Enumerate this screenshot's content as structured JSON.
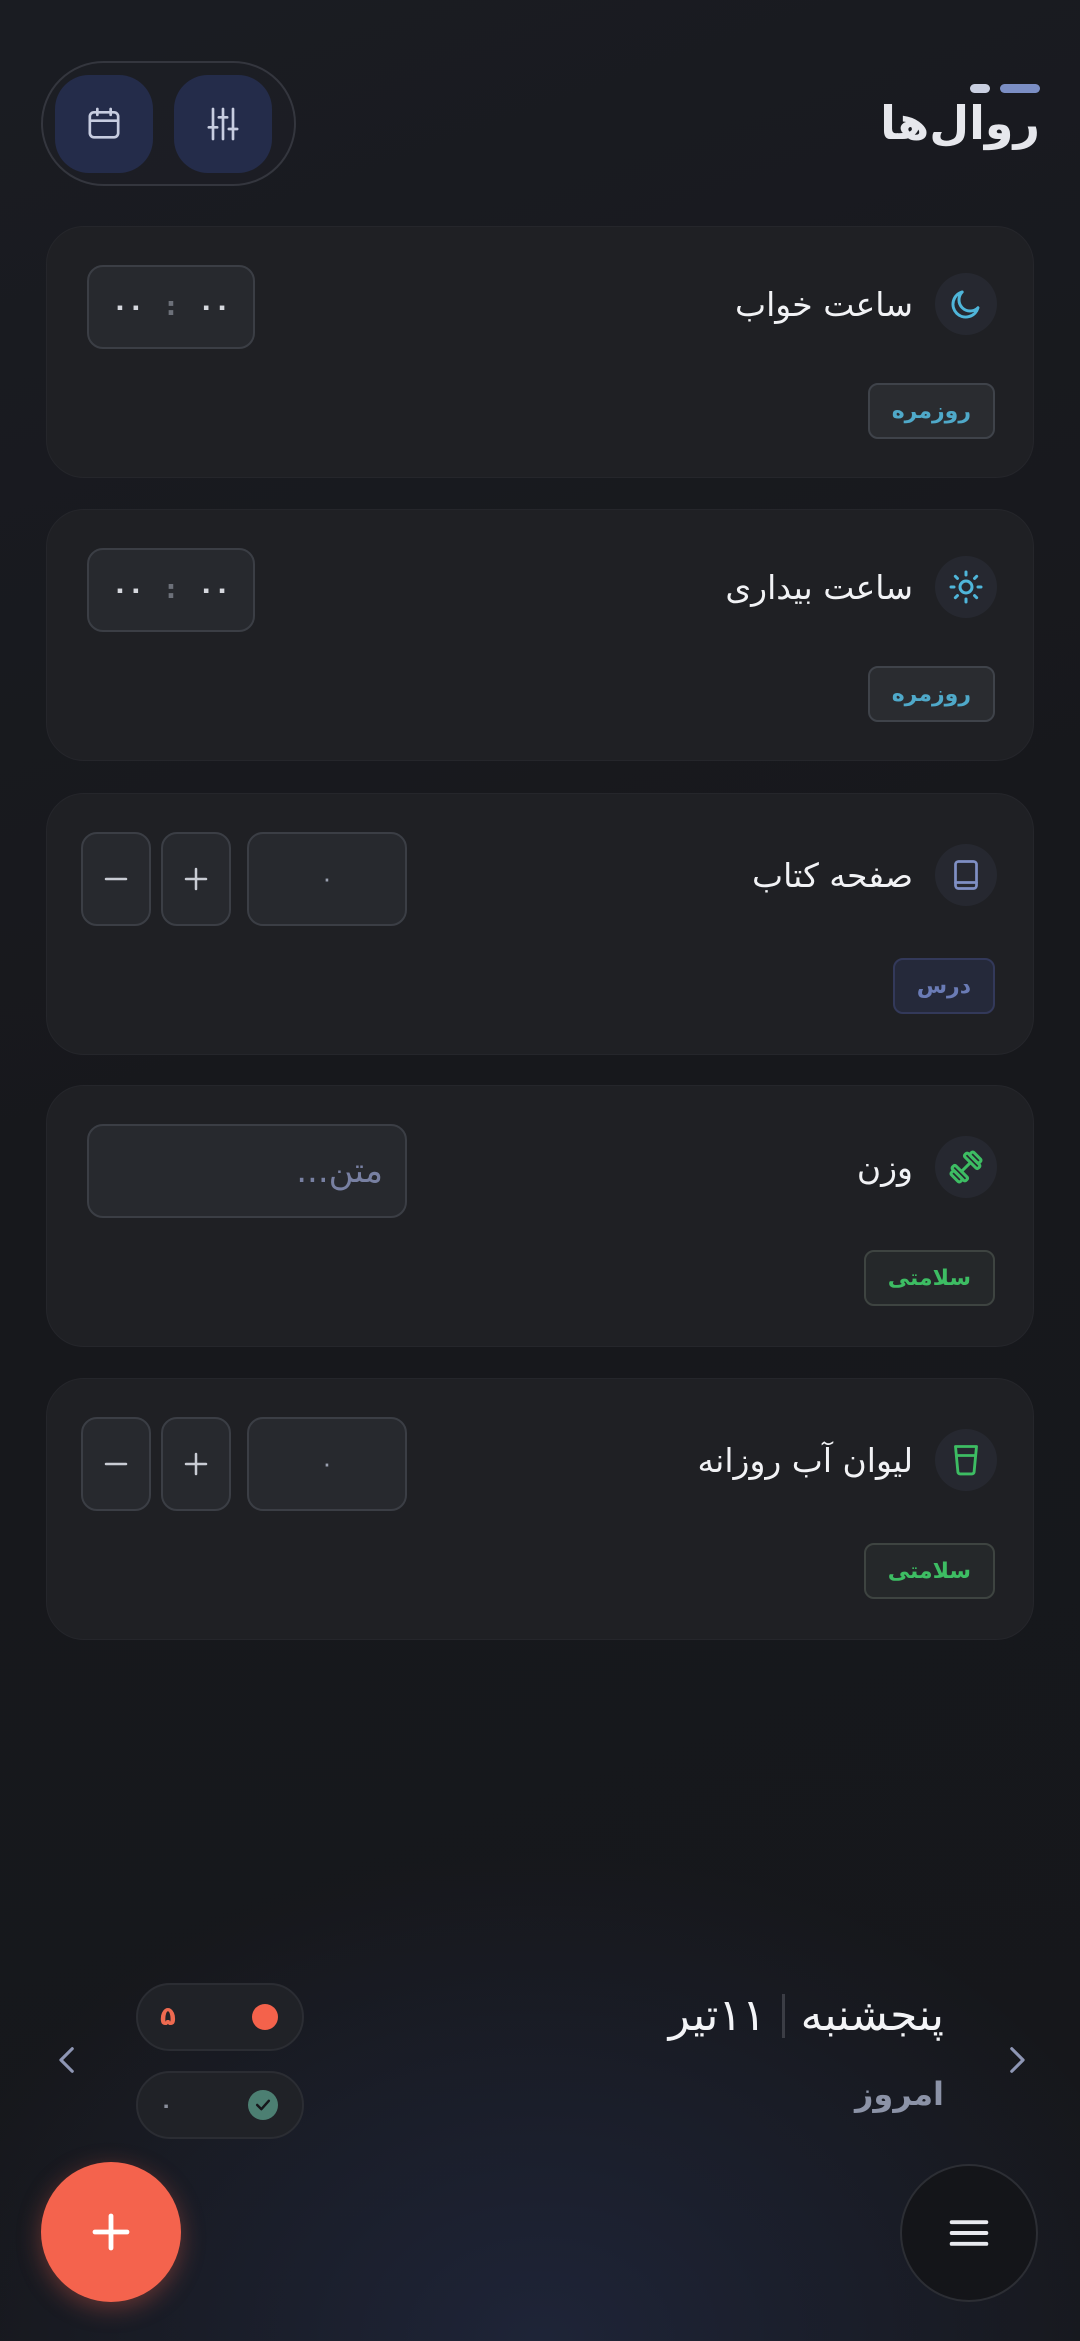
{
  "header": {
    "title": "روال‌ها",
    "calendar_icon": "calendar-icon",
    "filter_icon": "sliders-icon"
  },
  "cards": [
    {
      "title": "ساعت خواب",
      "icon": "moon-icon",
      "tag": "روزمره",
      "time": {
        "hours": "۰۰",
        "minutes": "۰۰",
        "separator": ":"
      }
    },
    {
      "title": "ساعت بیداری",
      "icon": "sun-icon",
      "tag": "روزمره",
      "time": {
        "hours": "۰۰",
        "minutes": "۰۰",
        "separator": ":"
      }
    },
    {
      "title": "صفحه کتاب",
      "icon": "book-icon",
      "tag": "درس",
      "value": "۰"
    },
    {
      "title": "وزن",
      "icon": "dumbbell-icon",
      "tag": "سلامتی",
      "placeholder": "متن..."
    },
    {
      "title": "لیوان آب روزانه",
      "icon": "glass-icon",
      "tag": "سلامتی",
      "value": "۰"
    }
  ],
  "date": {
    "weekday": "پنجشنبه",
    "day_month": "۱۱تیر",
    "relative": "امروز"
  },
  "stats": {
    "missed": "۵",
    "done": "۰"
  },
  "colors": {
    "accent": "#f4634d",
    "daily_tag": "#4fa9c9",
    "study_tag": "#6a7bb5",
    "health_tag": "#3dbd63",
    "header_button": "#242c4a"
  }
}
